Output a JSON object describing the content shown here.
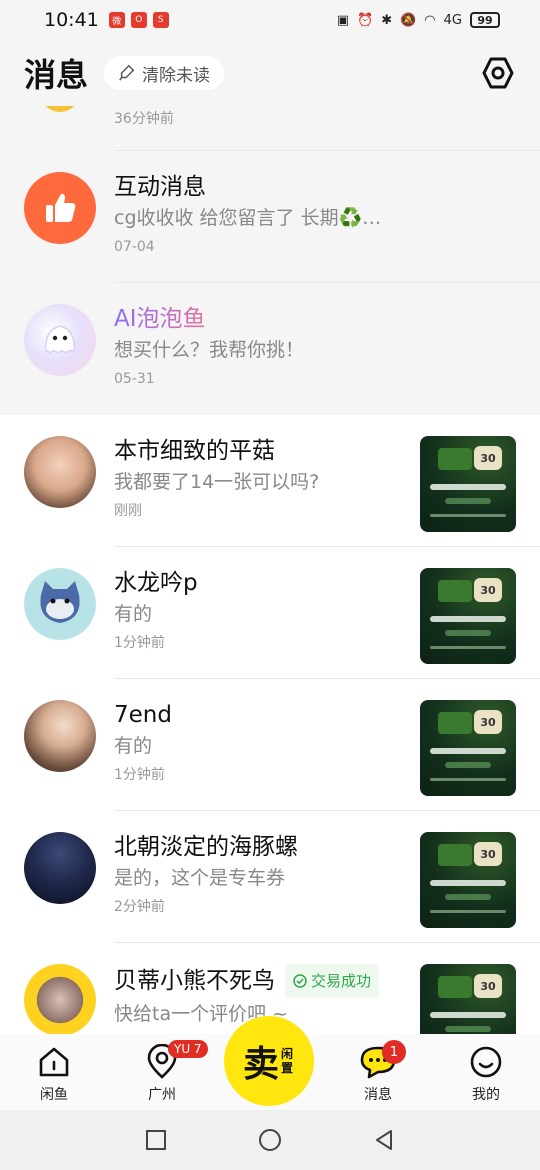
{
  "status_bar": {
    "time": "10:41",
    "apps": [
      "微",
      "O",
      "S"
    ],
    "signal": "4G",
    "battery": "99"
  },
  "header": {
    "title": "消息",
    "clear_unread": "清除未读"
  },
  "partial_row": {
    "time": "36分钟前"
  },
  "system_rows": [
    {
      "name": "互动消息",
      "preview": "cg收收收 给您留言了 长期♻️…",
      "time": "07-04"
    },
    {
      "name": "AI泡泡鱼",
      "preview": "想买什么？我帮你挑！",
      "time": "05-31"
    }
  ],
  "chats": [
    {
      "name": "本市细致的平菇",
      "preview": "我都要了14一张可以吗?",
      "time": "刚刚"
    },
    {
      "name": "水龙吟p",
      "preview": "有的",
      "time": "1分钟前"
    },
    {
      "name": "7end",
      "preview": "有的",
      "time": "1分钟前"
    },
    {
      "name": "北朝淡定的海豚螺",
      "preview": "是的，这个是专车券",
      "time": "2分钟前"
    },
    {
      "name": "贝蒂小熊不死鸟",
      "badge": "交易成功",
      "preview": "快给ta一个评价吧 ~",
      "time": ""
    }
  ],
  "thumb_badge": "30",
  "tabbar": {
    "tabs": [
      {
        "label": "闲鱼"
      },
      {
        "label": "广州",
        "badge": "YU 7"
      },
      {
        "label": "消息",
        "badge": "1"
      },
      {
        "label": "我的"
      }
    ],
    "sell_main": "卖",
    "sell_sub": "闲置"
  },
  "colors": {
    "accent": "#ffe60f",
    "badge": "#e02e24",
    "success": "#2da84b"
  }
}
